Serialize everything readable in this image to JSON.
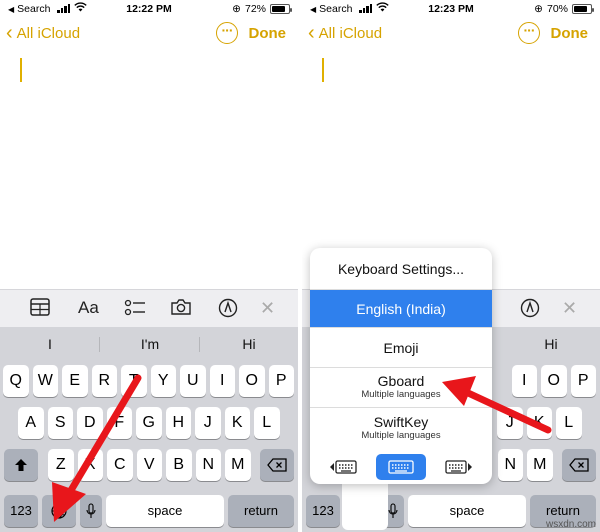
{
  "status": {
    "left": {
      "back_app": "Search",
      "time": "12:22 PM",
      "battery": "72%",
      "battery_level": 0.72
    },
    "right": {
      "back_app": "Search",
      "time": "12:23 PM",
      "battery": "70%",
      "battery_level": 0.7
    }
  },
  "nav": {
    "back_label": "All iCloud",
    "more_glyph": "···",
    "done_label": "Done"
  },
  "toolbar": {
    "format_label": "Aa",
    "icons": [
      "table-icon",
      "text-format-icon",
      "checklist-icon",
      "camera-icon",
      "markup-pen-icon",
      "close-icon"
    ],
    "close_glyph": "✕"
  },
  "suggestions": [
    "I",
    "I'm",
    "Hi"
  ],
  "keys": {
    "row1": [
      "Q",
      "W",
      "E",
      "R",
      "T",
      "Y",
      "U",
      "I",
      "O",
      "P"
    ],
    "row2": [
      "A",
      "S",
      "D",
      "F",
      "G",
      "H",
      "J",
      "K",
      "L"
    ],
    "row3": [
      "Z",
      "X",
      "C",
      "V",
      "B",
      "N",
      "M"
    ],
    "num_label": "123",
    "space_label": "space",
    "return_label": "return"
  },
  "keyboard_menu": {
    "settings": "Keyboard Settings...",
    "items": [
      {
        "title": "English (India)",
        "subtitle": "",
        "selected": true
      },
      {
        "title": "Emoji",
        "subtitle": "",
        "selected": false
      },
      {
        "title": "Gboard",
        "subtitle": "Multiple languages",
        "selected": false
      },
      {
        "title": "SwiftKey",
        "subtitle": "Multiple languages",
        "selected": false
      }
    ],
    "layout_options": [
      "keyboard-left-icon",
      "keyboard-full-icon",
      "keyboard-right-icon"
    ]
  },
  "colors": {
    "accent": "#d6a300",
    "selected": "#2f80ed",
    "arrow": "#e8161b",
    "keyboard_bg": "#d3d4d9"
  },
  "watermark": "wsxdn.com"
}
